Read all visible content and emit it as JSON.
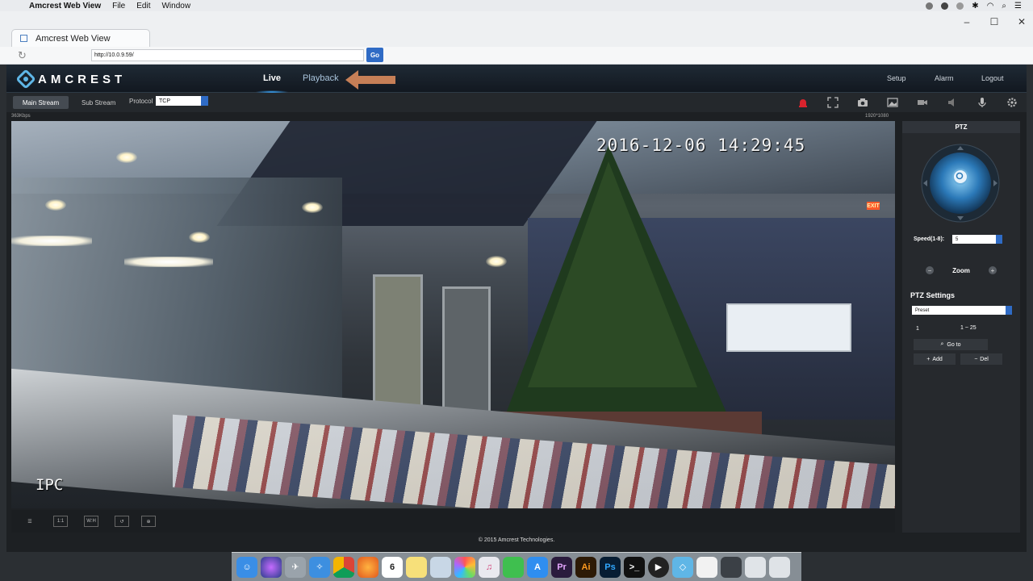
{
  "menubar": {
    "app_name": "Amcrest Web View",
    "menus": [
      "File",
      "Edit",
      "Window"
    ]
  },
  "browser": {
    "tab_title": "Amcrest Web View",
    "url": "http://10.0.9.59/",
    "go_label": "Go"
  },
  "app": {
    "logo_text": "AMCREST",
    "nav": {
      "live": "Live",
      "playback": "Playback"
    },
    "nav_right": {
      "setup": "Setup",
      "alarm": "Alarm",
      "logout": "Logout"
    },
    "stream": {
      "main": "Main Stream",
      "sub": "Sub Stream",
      "protocol_label": "Protocol",
      "protocol_value": "TCP"
    },
    "bitrate": "363Kbps",
    "resolution": "1920*1080",
    "osd": {
      "timestamp": "2016-12-06 14:29:45",
      "channel": "IPC"
    },
    "footer": "© 2015 Amcrest Technologies."
  },
  "ptz": {
    "title": "PTZ",
    "speed_label": "Speed(1-8):",
    "speed_value": "5",
    "zoom_label": "Zoom",
    "settings_title": "PTZ Settings",
    "preset_select": "Preset",
    "preset_number": "1",
    "preset_range": "1 ~ 25",
    "goto_label": "Go to",
    "add_label": "Add",
    "del_label": "Del"
  },
  "colors": {
    "accent_blue": "#2f6bc5",
    "brand_cyan": "#5fb6e6",
    "record_red": "#d9232d",
    "arrow_orange": "#d98a5c"
  },
  "toolbar_icons": [
    "record-icon",
    "fullscreen-icon",
    "snapshot-icon",
    "image-icon",
    "camera-icon",
    "audio-icon",
    "microphone-icon",
    "settings-icon"
  ],
  "dock_icons": [
    "finder-icon",
    "siri-icon",
    "launchpad-icon",
    "safari-icon",
    "chrome-icon",
    "firefox-icon",
    "calendar-icon",
    "notes-icon",
    "preview-icon",
    "photos-icon",
    "itunes-icon",
    "facetime-icon",
    "appstore-icon",
    "premiere-icon",
    "illustrator-icon",
    "photoshop-icon",
    "terminal-icon",
    "quicktime-icon",
    "amcrest-icon",
    "document-icon",
    "screenshot-icon",
    "folder-icon",
    "trash-icon"
  ],
  "dock_labels": {
    "calendar": "6",
    "premiere": "Pr",
    "illustrator": "Ai",
    "photoshop": "Ps"
  }
}
